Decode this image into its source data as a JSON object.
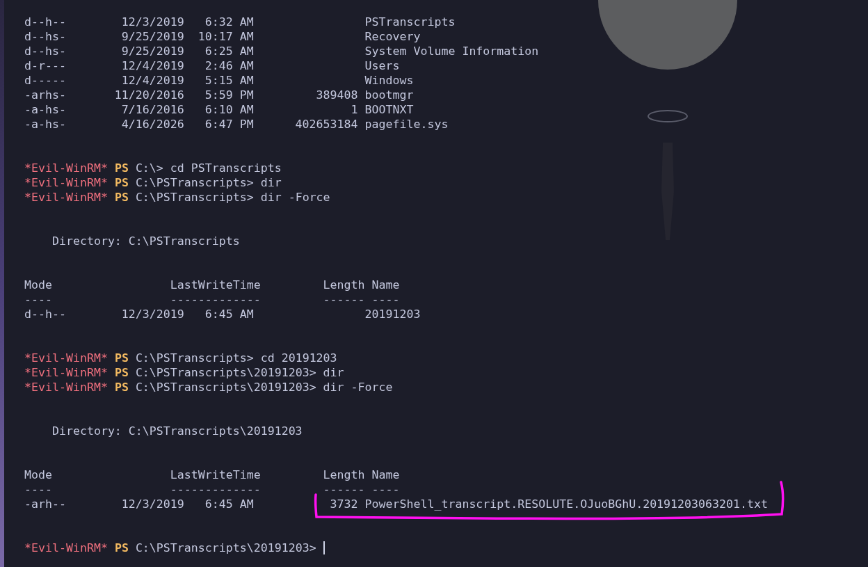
{
  "terminal": {
    "lines": [
      {
        "kind": "output",
        "text": "d--h--        12/3/2019   6:32 AM                PSTranscripts"
      },
      {
        "kind": "output",
        "text": "d--hs-        9/25/2019  10:17 AM                Recovery"
      },
      {
        "kind": "output",
        "text": "d--hs-        9/25/2019   6:25 AM                System Volume Information"
      },
      {
        "kind": "output",
        "text": "d-r---        12/4/2019   2:46 AM                Users"
      },
      {
        "kind": "output",
        "text": "d-----        12/4/2019   5:15 AM                Windows"
      },
      {
        "kind": "output",
        "text": "-arhs-       11/20/2016   5:59 PM         389408 bootmgr"
      },
      {
        "kind": "output",
        "text": "-a-hs-        7/16/2016   6:10 AM              1 BOOTNXT"
      },
      {
        "kind": "output",
        "text": "-a-hs-        4/16/2026   6:47 PM      402653184 pagefile.sys"
      },
      {
        "kind": "blank"
      },
      {
        "kind": "blank"
      },
      {
        "kind": "prompt",
        "marker": "*Evil-WinRM*",
        "shell": "PS",
        "input": "C:\\> cd PSTranscripts"
      },
      {
        "kind": "prompt",
        "marker": "*Evil-WinRM*",
        "shell": "PS",
        "input": "C:\\PSTranscripts> dir"
      },
      {
        "kind": "prompt",
        "marker": "*Evil-WinRM*",
        "shell": "PS",
        "input": "C:\\PSTranscripts> dir -Force"
      },
      {
        "kind": "blank"
      },
      {
        "kind": "blank"
      },
      {
        "kind": "output",
        "text": "    Directory: C:\\PSTranscripts"
      },
      {
        "kind": "blank"
      },
      {
        "kind": "blank"
      },
      {
        "kind": "output",
        "text": "Mode                 LastWriteTime         Length Name"
      },
      {
        "kind": "output",
        "text": "----                 -------------         ------ ----"
      },
      {
        "kind": "output",
        "text": "d--h--        12/3/2019   6:45 AM                20191203"
      },
      {
        "kind": "blank"
      },
      {
        "kind": "blank"
      },
      {
        "kind": "prompt",
        "marker": "*Evil-WinRM*",
        "shell": "PS",
        "input": "C:\\PSTranscripts> cd 20191203"
      },
      {
        "kind": "prompt",
        "marker": "*Evil-WinRM*",
        "shell": "PS",
        "input": "C:\\PSTranscripts\\20191203> dir"
      },
      {
        "kind": "prompt",
        "marker": "*Evil-WinRM*",
        "shell": "PS",
        "input": "C:\\PSTranscripts\\20191203> dir -Force"
      },
      {
        "kind": "blank"
      },
      {
        "kind": "blank"
      },
      {
        "kind": "output",
        "text": "    Directory: C:\\PSTranscripts\\20191203"
      },
      {
        "kind": "blank"
      },
      {
        "kind": "blank"
      },
      {
        "kind": "output",
        "text": "Mode                 LastWriteTime         Length Name"
      },
      {
        "kind": "output",
        "text": "----                 -------------         ------ ----"
      },
      {
        "kind": "output",
        "text": "-arh--        12/3/2019   6:45 AM           3732 PowerShell_transcript.RESOLUTE.OJuoBGhU.20191203063201.txt",
        "highlighted": true
      },
      {
        "kind": "blank"
      },
      {
        "kind": "blank"
      },
      {
        "kind": "prompt",
        "marker": "*Evil-WinRM*",
        "shell": "PS",
        "input": "C:\\PSTranscripts\\20191203> ",
        "cursor": true
      }
    ]
  }
}
